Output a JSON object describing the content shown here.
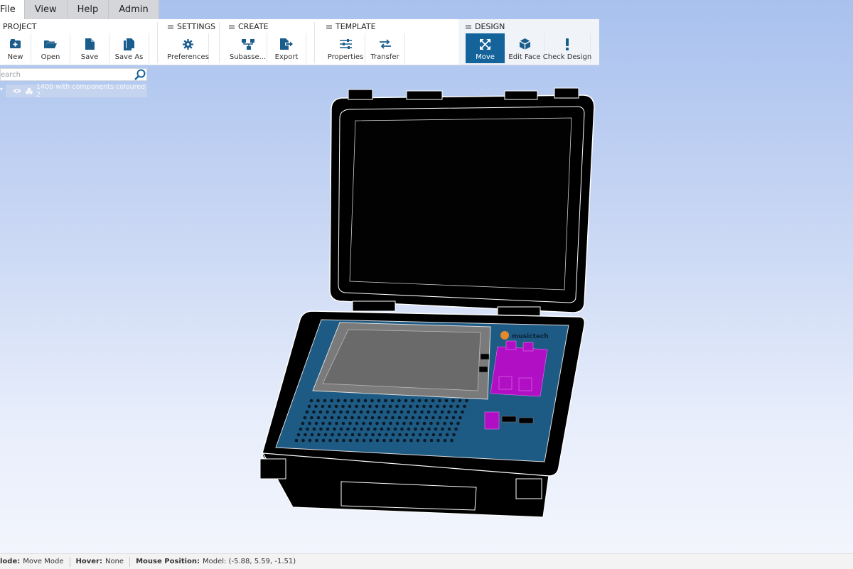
{
  "menu": {
    "tabs": [
      {
        "label": "File"
      },
      {
        "label": "View"
      },
      {
        "label": "Help"
      },
      {
        "label": "Admin"
      }
    ]
  },
  "ribbon": {
    "groups": {
      "project": "PROJECT",
      "settings": "SETTINGS",
      "create": "CREATE",
      "template": "TEMPLATE",
      "design": "DESIGN"
    },
    "buttons": {
      "new": "New",
      "open": "Open",
      "save": "Save",
      "save_as": "Save As",
      "preferences": "Preferences",
      "subassembly": "Subasse...",
      "export": "Export",
      "properties": "Properties",
      "transfer": "Transfer",
      "move": "Move",
      "edit_face": "Edit Face",
      "check_design": "Check Design"
    }
  },
  "sidebar": {
    "search_placeholder": "earch",
    "tree": [
      {
        "label": "1400 with components coloured 2"
      }
    ]
  },
  "model": {
    "brand_label": "musictech",
    "colors": {
      "case": "#000000",
      "panel": "#1d5a84",
      "screen": "#6e6e6e",
      "components": "#b10fc4"
    }
  },
  "status": {
    "mode_label": "Mode:",
    "mode_label_visible": "lode:",
    "mode_value": "Move Mode",
    "hover_label": "Hover:",
    "hover_value": "None",
    "mouse_label": "Mouse Position:",
    "mouse_value": "Model: (-5.88, 5.59, -1.51)"
  },
  "colors": {
    "accent": "#14639b",
    "icon": "#1a5c8c"
  }
}
